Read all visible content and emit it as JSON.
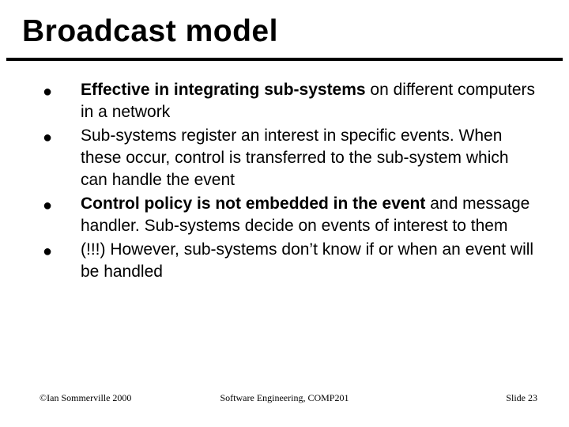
{
  "title": "Broadcast model",
  "bullets": [
    {
      "bold_lead": "Effective in integrating sub-systems",
      "rest": " on different computers in a network"
    },
    {
      "bold_lead": "",
      "rest": "Sub-systems register an interest in specific events. When these occur, control is transferred to the sub-system which can handle the event"
    },
    {
      "bold_lead": "Control policy is not embedded in the event",
      "rest": " and message handler. Sub-systems decide on events of interest to them"
    },
    {
      "bold_lead": "",
      "rest": "(!!!) However, sub-systems don’t know if or when an event will be handled"
    }
  ],
  "footer": {
    "left": "©Ian Sommerville 2000",
    "center": "Software Engineering, COMP201",
    "right": "Slide 23"
  },
  "glyphs": {
    "bullet": "●"
  }
}
